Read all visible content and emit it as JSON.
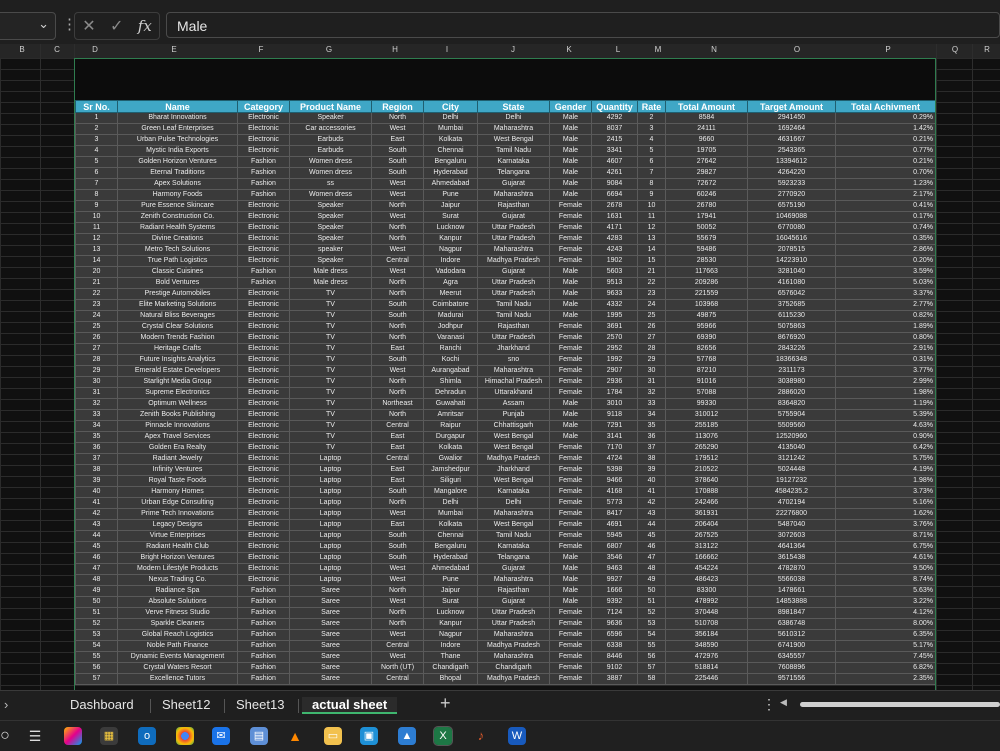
{
  "formula_bar": {
    "value": "Male",
    "fx_label": "fx"
  },
  "column_letters": [
    "B",
    "C",
    "D",
    "E",
    "F",
    "G",
    "H",
    "I",
    "J",
    "K",
    "L",
    "M",
    "N",
    "O",
    "P",
    "Q",
    "R"
  ],
  "table": {
    "headers": [
      "Sr No.",
      "Name",
      "Category",
      "Product Name",
      "Region",
      "City",
      "State",
      "Gender",
      "Quantity",
      "Rate",
      "Total Amount",
      "Target Amount",
      "Total Achivment"
    ],
    "rows": [
      [
        "1",
        "Bharat Innovations",
        "Electronic",
        "Speaker",
        "North",
        "Delhi",
        "Delhi",
        "Male",
        "4292",
        "2",
        "8584",
        "2941450",
        "0.29%"
      ],
      [
        "2",
        "Green Leaf Enterprises",
        "Electronic",
        "Car accessories",
        "West",
        "Mumbai",
        "Maharashtra",
        "Male",
        "8037",
        "3",
        "24111",
        "1692464",
        "1.42%"
      ],
      [
        "3",
        "Urban Pulse Technologies",
        "Electronic",
        "Earbuds",
        "East",
        "Kolkata",
        "West Bengal",
        "Male",
        "2415",
        "4",
        "9660",
        "4631667",
        "0.21%"
      ],
      [
        "4",
        "Mystic India Exports",
        "Electronic",
        "Earbuds",
        "South",
        "Chennai",
        "Tamil Nadu",
        "Male",
        "3341",
        "5",
        "19705",
        "2543365",
        "0.77%"
      ],
      [
        "5",
        "Golden Horizon Ventures",
        "Fashion",
        "Women dress",
        "South",
        "Bengaluru",
        "Karnataka",
        "Male",
        "4607",
        "6",
        "27642",
        "13394612",
        "0.21%"
      ],
      [
        "6",
        "Eternal Traditions",
        "Fashion",
        "Women dress",
        "South",
        "Hyderabad",
        "Telangana",
        "Male",
        "4261",
        "7",
        "29827",
        "4264220",
        "0.70%"
      ],
      [
        "7",
        "Apex Solutions",
        "Fashion",
        "ss",
        "West",
        "Ahmedabad",
        "Gujarat",
        "Male",
        "9084",
        "8",
        "72672",
        "5923233",
        "1.23%"
      ],
      [
        "8",
        "Harmony Foods",
        "Fashion",
        "Women dress",
        "West",
        "Pune",
        "Maharashtra",
        "Male",
        "6694",
        "9",
        "60246",
        "2770920",
        "2.17%"
      ],
      [
        "9",
        "Pure Essence Skincare",
        "Electronic",
        "Speaker",
        "North",
        "Jaipur",
        "Rajasthan",
        "Female",
        "2678",
        "10",
        "26780",
        "6575190",
        "0.41%"
      ],
      [
        "10",
        "Zenith Construction Co.",
        "Electronic",
        "Speaker",
        "West",
        "Surat",
        "Gujarat",
        "Female",
        "1631",
        "11",
        "17941",
        "10469088",
        "0.17%"
      ],
      [
        "11",
        "Radiant Health Systems",
        "Electronic",
        "Speaker",
        "North",
        "Lucknow",
        "Uttar Pradesh",
        "Female",
        "4171",
        "12",
        "50052",
        "6770080",
        "0.74%"
      ],
      [
        "12",
        "Divine Creations",
        "Electronic",
        "Speaker",
        "North",
        "Kanpur",
        "Uttar Pradesh",
        "Female",
        "4283",
        "13",
        "55679",
        "16045616",
        "0.35%"
      ],
      [
        "13",
        "Metro Tech Solutions",
        "Electronic",
        "speaker",
        "West",
        "Nagpur",
        "Maharashtra",
        "Female",
        "4243",
        "14",
        "59486",
        "2078515",
        "2.86%"
      ],
      [
        "14",
        "True Path Logistics",
        "Electronic",
        "Speaker",
        "Central",
        "Indore",
        "Madhya Pradesh",
        "Female",
        "1902",
        "15",
        "28530",
        "14223910",
        "0.20%"
      ],
      [
        "20",
        "Classic Cuisines",
        "Fashion",
        "Male dress",
        "West",
        "Vadodara",
        "Gujarat",
        "Male",
        "5603",
        "21",
        "117663",
        "3281040",
        "3.59%"
      ],
      [
        "21",
        "Bold Ventures",
        "Fashion",
        "Male dress",
        "North",
        "Agra",
        "Uttar Pradesh",
        "Male",
        "9513",
        "22",
        "209286",
        "4161080",
        "5.03%"
      ],
      [
        "22",
        "Prestige Automobiles",
        "Electronic",
        "TV",
        "North",
        "Meerut",
        "Uttar Pradesh",
        "Male",
        "9633",
        "23",
        "221559",
        "6576042",
        "3.37%"
      ],
      [
        "23",
        "Elite Marketing Solutions",
        "Electronic",
        "TV",
        "South",
        "Coimbatore",
        "Tamil Nadu",
        "Male",
        "4332",
        "24",
        "103968",
        "3752685",
        "2.77%"
      ],
      [
        "24",
        "Natural Bliss Beverages",
        "Electronic",
        "TV",
        "South",
        "Madurai",
        "Tamil Nadu",
        "Male",
        "1995",
        "25",
        "49875",
        "6115230",
        "0.82%"
      ],
      [
        "25",
        "Crystal Clear Solutions",
        "Electronic",
        "TV",
        "North",
        "Jodhpur",
        "Rajasthan",
        "Female",
        "3691",
        "26",
        "95966",
        "5075863",
        "1.89%"
      ],
      [
        "26",
        "Modern Trends Fashion",
        "Electronic",
        "TV",
        "North",
        "Varanasi",
        "Uttar Pradesh",
        "Female",
        "2570",
        "27",
        "69390",
        "8676920",
        "0.80%"
      ],
      [
        "27",
        "Heritage Crafts",
        "Electronic",
        "TV",
        "East",
        "Ranchi",
        "Jharkhand",
        "Female",
        "2952",
        "28",
        "82656",
        "2843226",
        "2.91%"
      ],
      [
        "28",
        "Future Insights Analytics",
        "Electronic",
        "TV",
        "South",
        "Kochi",
        "sno",
        "Female",
        "1992",
        "29",
        "57768",
        "18366348",
        "0.31%"
      ],
      [
        "29",
        "Emerald Estate Developers",
        "Electronic",
        "TV",
        "West",
        "Aurangabad",
        "Maharashtra",
        "Female",
        "2907",
        "30",
        "87210",
        "2311173",
        "3.77%"
      ],
      [
        "30",
        "Starlight Media Group",
        "Electronic",
        "TV",
        "North",
        "Shimla",
        "Himachal Pradesh",
        "Female",
        "2936",
        "31",
        "91016",
        "3038980",
        "2.99%"
      ],
      [
        "31",
        "Supreme Electronics",
        "Electronic",
        "TV",
        "North",
        "Dehradun",
        "Uttarakhand",
        "Female",
        "1784",
        "32",
        "57088",
        "2886020",
        "1.98%"
      ],
      [
        "32",
        "Optimum Wellness",
        "Electronic",
        "TV",
        "Northeast",
        "Guwahati",
        "Assam",
        "Male",
        "3010",
        "33",
        "99330",
        "8364820",
        "1.19%"
      ],
      [
        "33",
        "Zenith Books Publishing",
        "Electronic",
        "TV",
        "North",
        "Amritsar",
        "Punjab",
        "Male",
        "9118",
        "34",
        "310012",
        "5755904",
        "5.39%"
      ],
      [
        "34",
        "Pinnacle Innovations",
        "Electronic",
        "TV",
        "Central",
        "Raipur",
        "Chhattisgarh",
        "Male",
        "7291",
        "35",
        "255185",
        "5509560",
        "4.63%"
      ],
      [
        "35",
        "Apex Travel Services",
        "Electronic",
        "TV",
        "East",
        "Durgapur",
        "West Bengal",
        "Male",
        "3141",
        "36",
        "113076",
        "12520960",
        "0.90%"
      ],
      [
        "36",
        "Golden Era Realty",
        "Electronic",
        "TV",
        "East",
        "Kolkata",
        "West Bengal",
        "Female",
        "7170",
        "37",
        "265290",
        "4135040",
        "6.42%"
      ],
      [
        "37",
        "Radiant Jewelry",
        "Electronic",
        "Laptop",
        "Central",
        "Gwalior",
        "Madhya Pradesh",
        "Female",
        "4724",
        "38",
        "179512",
        "3121242",
        "5.75%"
      ],
      [
        "38",
        "Infinity Ventures",
        "Electronic",
        "Laptop",
        "East",
        "Jamshedpur",
        "Jharkhand",
        "Female",
        "5398",
        "39",
        "210522",
        "5024448",
        "4.19%"
      ],
      [
        "39",
        "Royal Taste Foods",
        "Electronic",
        "Laptop",
        "East",
        "Siliguri",
        "West Bengal",
        "Female",
        "9466",
        "40",
        "378640",
        "19127232",
        "1.98%"
      ],
      [
        "40",
        "Harmony Homes",
        "Electronic",
        "Laptop",
        "South",
        "Mangalore",
        "Karnataka",
        "Female",
        "4168",
        "41",
        "170888",
        "4584235.2",
        "3.73%"
      ],
      [
        "41",
        "Urban Edge Consulting",
        "Electronic",
        "Laptop",
        "North",
        "Delhi",
        "Delhi",
        "Female",
        "5773",
        "42",
        "242466",
        "4702194",
        "5.16%"
      ],
      [
        "42",
        "Prime Tech Innovations",
        "Electronic",
        "Laptop",
        "West",
        "Mumbai",
        "Maharashtra",
        "Female",
        "8417",
        "43",
        "361931",
        "22276800",
        "1.62%"
      ],
      [
        "43",
        "Legacy Designs",
        "Electronic",
        "Laptop",
        "East",
        "Kolkata",
        "West Bengal",
        "Female",
        "4691",
        "44",
        "206404",
        "5487040",
        "3.76%"
      ],
      [
        "44",
        "Virtue Enterprises",
        "Electronic",
        "Laptop",
        "South",
        "Chennai",
        "Tamil Nadu",
        "Female",
        "5945",
        "45",
        "267525",
        "3072603",
        "8.71%"
      ],
      [
        "45",
        "Radiant Health Club",
        "Electronic",
        "Laptop",
        "South",
        "Bengaluru",
        "Karnataka",
        "Female",
        "6807",
        "46",
        "313122",
        "4641364",
        "6.75%"
      ],
      [
        "46",
        "Bright Horizon Ventures",
        "Electronic",
        "Laptop",
        "South",
        "Hyderabad",
        "Telangana",
        "Male",
        "3546",
        "47",
        "166662",
        "3615438",
        "4.61%"
      ],
      [
        "47",
        "Modern Lifestyle Products",
        "Electronic",
        "Laptop",
        "West",
        "Ahmedabad",
        "Gujarat",
        "Male",
        "9463",
        "48",
        "454224",
        "4782870",
        "9.50%"
      ],
      [
        "48",
        "Nexus Trading Co.",
        "Electronic",
        "Laptop",
        "West",
        "Pune",
        "Maharashtra",
        "Male",
        "9927",
        "49",
        "486423",
        "5566038",
        "8.74%"
      ],
      [
        "49",
        "Radiance Spa",
        "Fashion",
        "Saree",
        "North",
        "Jaipur",
        "Rajasthan",
        "Male",
        "1666",
        "50",
        "83300",
        "1478661",
        "5.63%"
      ],
      [
        "50",
        "Absolute Solutions",
        "Fashion",
        "Saree",
        "West",
        "Surat",
        "Gujarat",
        "Male",
        "9392",
        "51",
        "478992",
        "14853888",
        "3.22%"
      ],
      [
        "51",
        "Verve Fitness Studio",
        "Fashion",
        "Saree",
        "North",
        "Lucknow",
        "Uttar Pradesh",
        "Female",
        "7124",
        "52",
        "370448",
        "8981847",
        "4.12%"
      ],
      [
        "52",
        "Sparkle Cleaners",
        "Fashion",
        "Saree",
        "North",
        "Kanpur",
        "Uttar Pradesh",
        "Female",
        "9636",
        "53",
        "510708",
        "6386748",
        "8.00%"
      ],
      [
        "53",
        "Global Reach Logistics",
        "Fashion",
        "Saree",
        "West",
        "Nagpur",
        "Maharashtra",
        "Female",
        "6596",
        "54",
        "356184",
        "5610312",
        "6.35%"
      ],
      [
        "54",
        "Noble Path Finance",
        "Fashion",
        "Saree",
        "Central",
        "Indore",
        "Madhya Pradesh",
        "Female",
        "6338",
        "55",
        "348590",
        "6741900",
        "5.17%"
      ],
      [
        "55",
        "Dynamic Events Management",
        "Fashion",
        "Saree",
        "West",
        "Thane",
        "Maharashtra",
        "Female",
        "8446",
        "56",
        "472976",
        "6345557",
        "7.45%"
      ],
      [
        "56",
        "Crystal Waters Resort",
        "Fashion",
        "Saree",
        "North (UT)",
        "Chandigarh",
        "Chandigarh",
        "Female",
        "9102",
        "57",
        "518814",
        "7608896",
        "6.82%"
      ],
      [
        "57",
        "Excellence Tutors",
        "Fashion",
        "Saree",
        "Central",
        "Bhopal",
        "Madhya Pradesh",
        "Female",
        "3887",
        "58",
        "225446",
        "9571556",
        "2.35%"
      ]
    ]
  },
  "sheet_tabs": [
    "Dashboard",
    "Sheet12",
    "Sheet13",
    "actual sheet"
  ],
  "active_tab": "actual sheet"
}
